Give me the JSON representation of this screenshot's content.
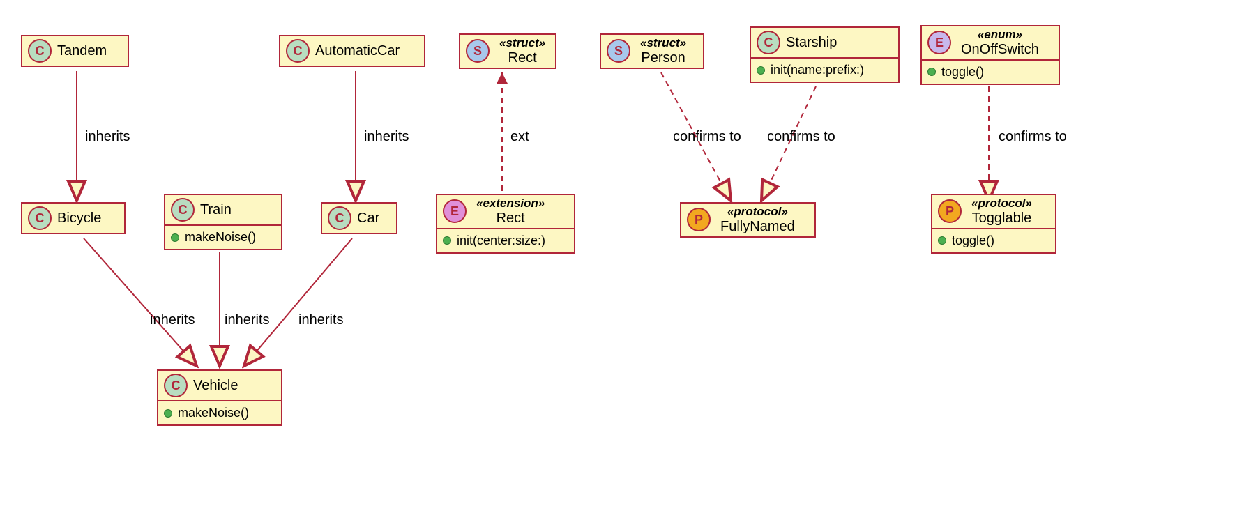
{
  "nodes": {
    "tandem": {
      "kind": "C",
      "name": "Tandem"
    },
    "bicycle": {
      "kind": "C",
      "name": "Bicycle"
    },
    "train": {
      "kind": "C",
      "name": "Train",
      "members": [
        "makeNoise()"
      ]
    },
    "automaticCar": {
      "kind": "C",
      "name": "AutomaticCar"
    },
    "car": {
      "kind": "C",
      "name": "Car"
    },
    "vehicle": {
      "kind": "C",
      "name": "Vehicle",
      "members": [
        "makeNoise()"
      ]
    },
    "rectStruct": {
      "kind": "S",
      "stereo": "«struct»",
      "name": "Rect"
    },
    "rectExt": {
      "kind": "E",
      "stereo": "«extension»",
      "name": "Rect",
      "members": [
        "init(center:size:)"
      ]
    },
    "person": {
      "kind": "S",
      "stereo": "«struct»",
      "name": "Person"
    },
    "starship": {
      "kind": "C",
      "name": "Starship",
      "members": [
        "init(name:prefix:)"
      ]
    },
    "fullyNamed": {
      "kind": "P",
      "stereo": "«protocol»",
      "name": "FullyNamed"
    },
    "onOffSwitch": {
      "kind": "Eenum",
      "stereo": "«enum»",
      "name": "OnOffSwitch",
      "members": [
        "toggle()"
      ]
    },
    "togglable": {
      "kind": "P",
      "stereo": "«protocol»",
      "name": "Togglable",
      "members": [
        "toggle()"
      ]
    }
  },
  "edges": {
    "tandem_bicycle": {
      "label": "inherits"
    },
    "autoCar_car": {
      "label": "inherits"
    },
    "bicycle_vehicle": {
      "label": "inherits"
    },
    "train_vehicle": {
      "label": "inherits"
    },
    "car_vehicle": {
      "label": "inherits"
    },
    "rectExt_rect": {
      "label": "ext"
    },
    "person_fully": {
      "label": "confirms to"
    },
    "starship_fully": {
      "label": "confirms to"
    },
    "onoff_togglable": {
      "label": "confirms to"
    }
  }
}
